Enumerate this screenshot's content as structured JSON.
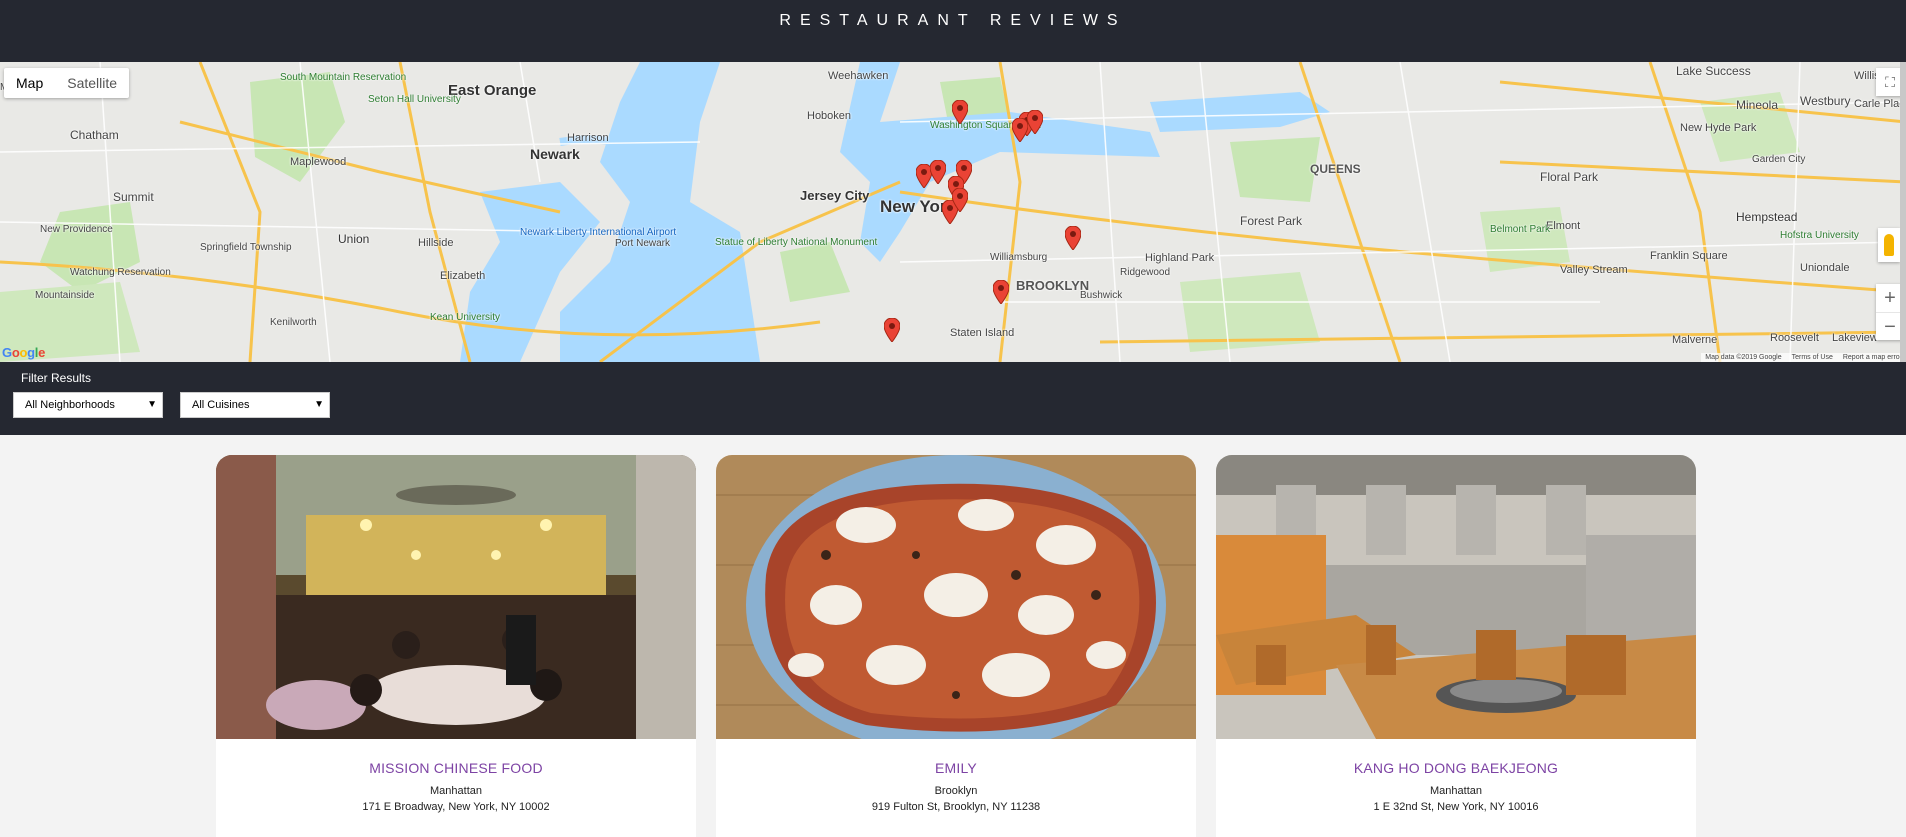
{
  "header": {
    "title": "RESTAURANT REVIEWS"
  },
  "map": {
    "type_control": {
      "map_label": "Map",
      "satellite_label": "Satellite"
    },
    "zoom_in_label": "+",
    "zoom_out_label": "−",
    "google_logo": "Google",
    "attribution": {
      "data": "Map data ©2019 Google",
      "terms": "Terms of Use",
      "report": "Report a map error"
    },
    "labels": [
      "East Orange",
      "Newark",
      "Jersey City",
      "New York",
      "Hoboken",
      "Weehawken",
      "BROOKLYN",
      "QUEENS",
      "Maplewood",
      "Summit",
      "Chatham",
      "Union",
      "Hillside",
      "Elizabeth",
      "Staten Island",
      "Forest Park",
      "Hempstead",
      "Mineola",
      "Floral Park",
      "Lake Success",
      "Westbury",
      "Elmont",
      "Valley Stream",
      "Highland Park",
      "Kenilworth",
      "Springfield Township",
      "New Providence",
      "Watchung Reservation",
      "South Mountain Reservation",
      "Seton Hall University",
      "Kean University",
      "Newark Liberty International Airport",
      "Port Newark",
      "Statue of Liberty National Monument",
      "Washington Square Park",
      "Harrison",
      "Belmont Park",
      "Hofstra University",
      "Garden City",
      "Williamsburg",
      "Ridgewood",
      "Bushwick",
      "Mountainside",
      "Madison",
      "Carle Place",
      "Williston Park",
      "New Hyde Park",
      "Uniondale",
      "Roosevelt",
      "Malverne",
      "Lakeview",
      "Franklin Square"
    ],
    "marker_count": 13
  },
  "filter": {
    "title": "Filter Results",
    "neighborhoods": {
      "selected": "All Neighborhoods"
    },
    "cuisines": {
      "selected": "All Cuisines"
    }
  },
  "restaurants": [
    {
      "name": "MISSION CHINESE FOOD",
      "neighborhood": "Manhattan",
      "address": "171 E Broadway, New York, NY 10002"
    },
    {
      "name": "EMILY",
      "neighborhood": "Brooklyn",
      "address": "919 Fulton St, Brooklyn, NY 11238"
    },
    {
      "name": "KANG HO DONG BAEKJEONG",
      "neighborhood": "Manhattan",
      "address": "1 E 32nd St, New York, NY 10016"
    }
  ],
  "colors": {
    "header_bg": "#252831",
    "accent_name": "#7d43a4",
    "marker": "#ea4335",
    "water": "#aadaff",
    "park": "#c8e6b4"
  }
}
